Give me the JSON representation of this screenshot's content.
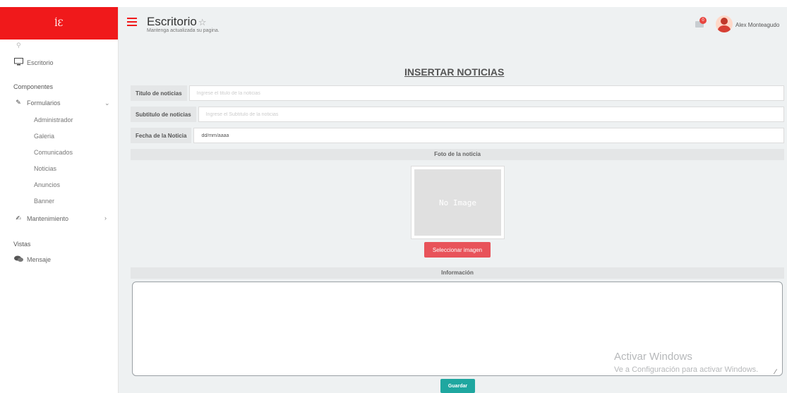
{
  "brand": {
    "logo_text": "ĺƐ"
  },
  "sidebar": {
    "dashboard_label": "Escritorio",
    "section_components": "Componentes",
    "forms_label": "Formularios",
    "forms_items": [
      "Administrador",
      "Galeria",
      "Comunicados",
      "Noticias",
      "Anuncios",
      "Banner"
    ],
    "maintenance_label": "Mantenimiento",
    "section_views": "Vistas",
    "messages_label": "Mensaje"
  },
  "header": {
    "title": "Escritorio",
    "subtitle": "Mantenga actualizada su pagina.",
    "notification_count": "0",
    "user_name": "Alex Monteagudo"
  },
  "form": {
    "title": "INSERTAR NOTICIAS",
    "title_field": {
      "label": "Titulo de noticias",
      "placeholder": "Ingrese el titulo de la noticias"
    },
    "subtitle_field": {
      "label": "Subtitulo de noticias",
      "placeholder": "Ingrese el Subtitulo de la noticias"
    },
    "date_field": {
      "label": "Fecha de la Noticia",
      "value": "dd/mm/aaaa"
    },
    "photo_section": "Foto de la noticia",
    "no_image_text": "No Image",
    "select_image_button": "Seleccionar imagen",
    "info_section": "Información",
    "save_button": "Guardar"
  },
  "watermark": {
    "line1": "Activar Windows",
    "line2": "Ve a Configuración para activar Windows."
  },
  "colors": {
    "brand_red": "#f0191b",
    "select_button": "#e8535a",
    "save_button": "#1fa7a0"
  },
  "icons": [
    "search-icon",
    "monitor-icon",
    "pencil-icon",
    "chevron-down-icon",
    "edit-icon",
    "chevron-right-icon",
    "comments-icon",
    "menu-icon",
    "star-icon",
    "envelope-icon"
  ]
}
